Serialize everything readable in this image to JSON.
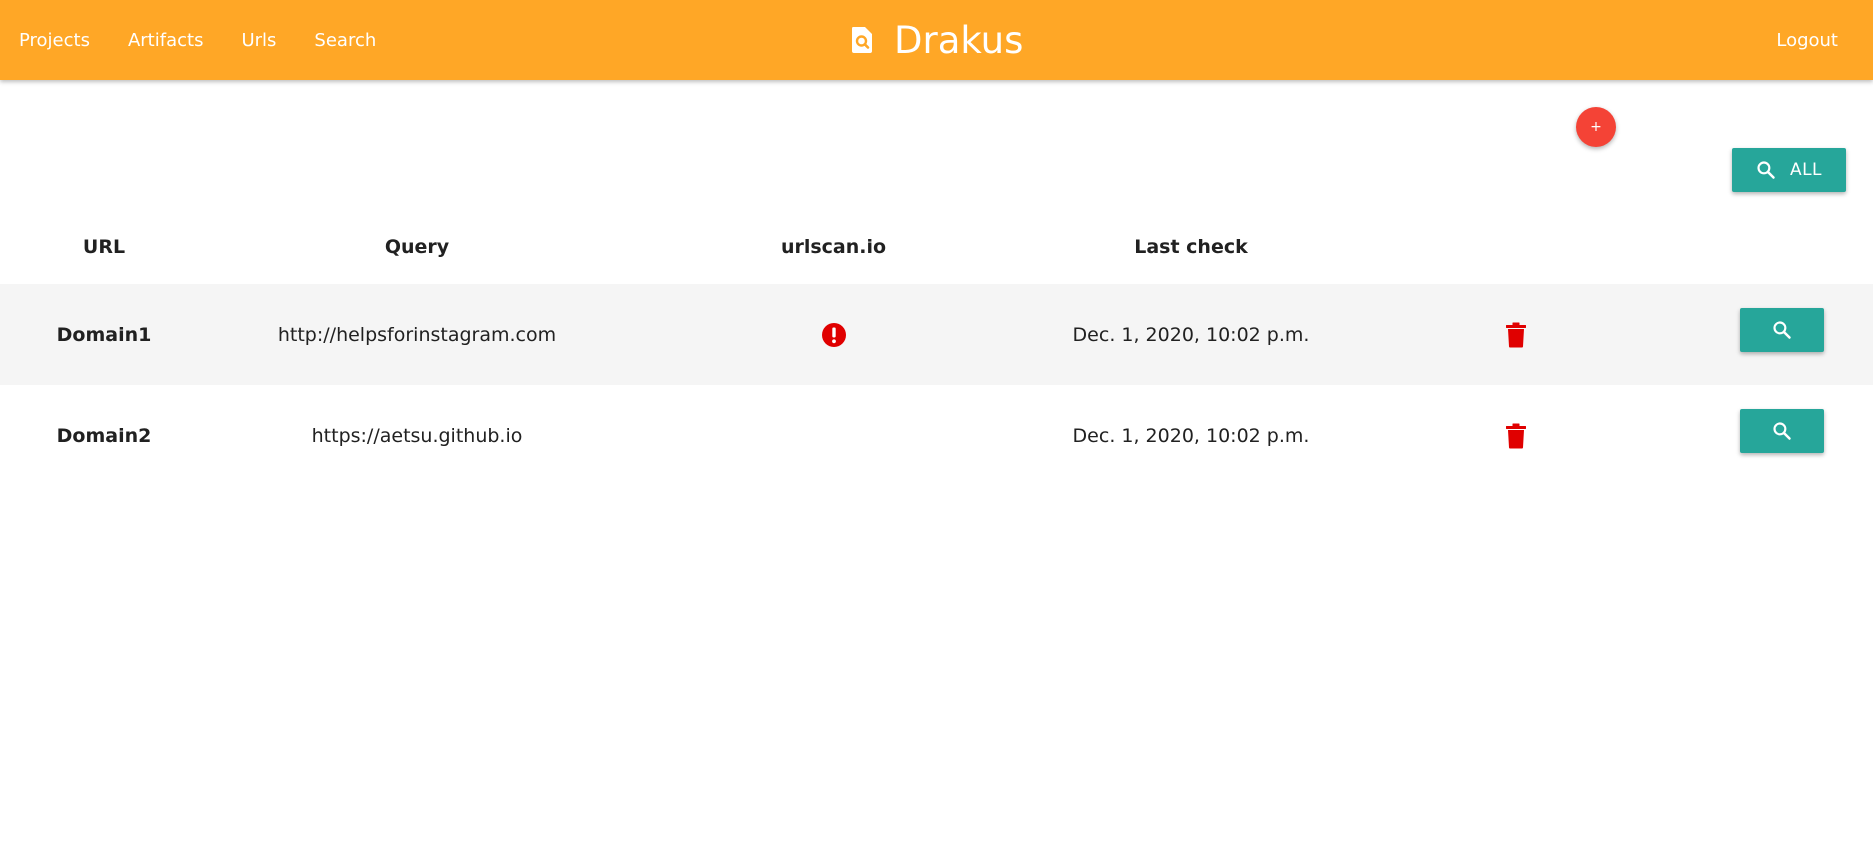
{
  "nav": {
    "links": [
      "Projects",
      "Artifacts",
      "Urls",
      "Search"
    ],
    "brand": "Drakus",
    "logout": "Logout",
    "color": "#ffa726"
  },
  "actions": {
    "add_label": "+",
    "search_all_label": "ALL",
    "add_color": "#f44336",
    "search_color": "#26a69a"
  },
  "table": {
    "headers": [
      "URL",
      "Query",
      "urlscan.io",
      "Last check"
    ],
    "rows": [
      {
        "name": "Domain1",
        "query": "http://helpsforinstagram.com",
        "urlscan_alert": true,
        "last_check": "Dec. 1, 2020, 10:02 p.m."
      },
      {
        "name": "Domain2",
        "query": "https://aetsu.github.io",
        "urlscan_alert": false,
        "last_check": "Dec. 1, 2020, 10:02 p.m."
      }
    ]
  },
  "icons": {
    "brand": "search-document-icon",
    "alert": "exclamation-circle-icon",
    "delete": "trash-icon",
    "search": "search-icon"
  }
}
